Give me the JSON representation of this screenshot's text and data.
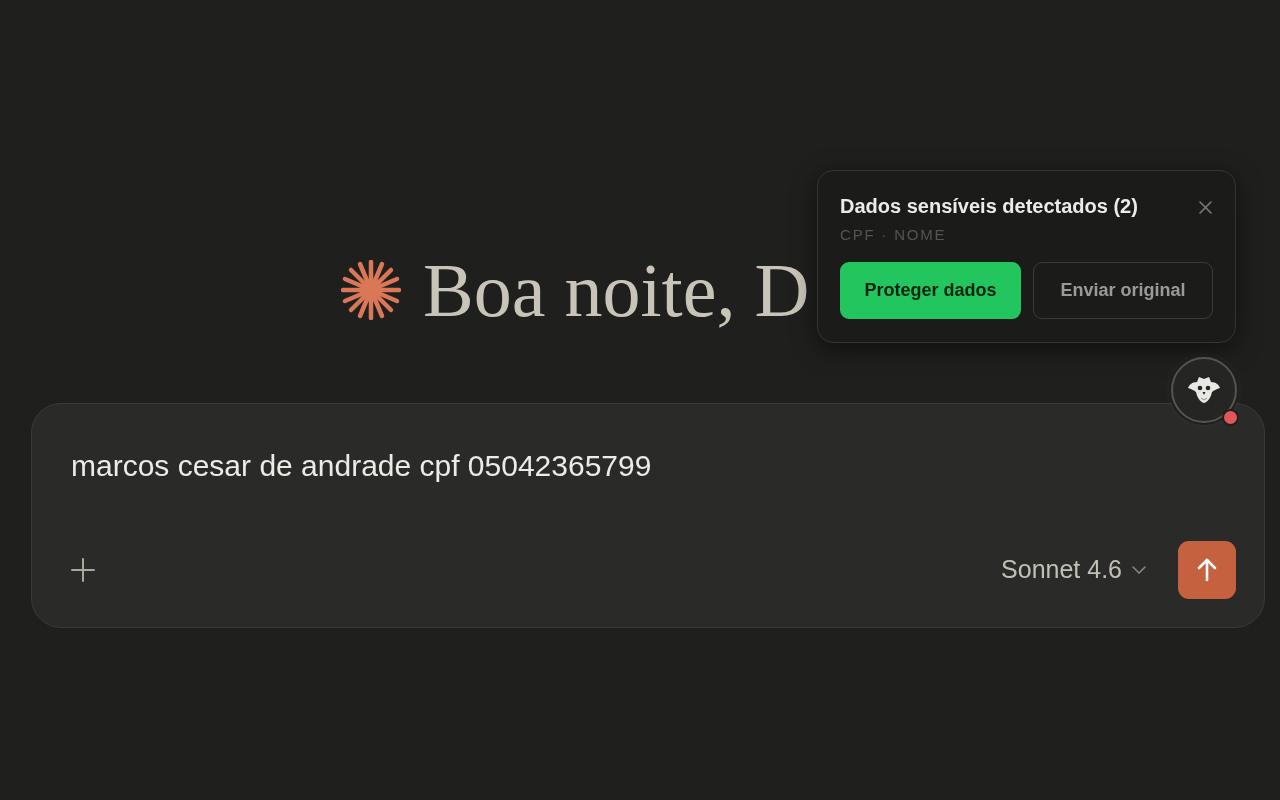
{
  "greeting": {
    "text": "Boa noite, D"
  },
  "composer": {
    "value": "marcos cesar de andrade cpf 05042365799",
    "model": "Sonnet 4.6"
  },
  "assistant_badge": {
    "alert": true
  },
  "alert_popup": {
    "title": "Dados sensíveis detectados (2)",
    "detected": "CPF · NOME",
    "buttons": [
      {
        "label": "Proteger dados",
        "kind": "primary"
      },
      {
        "label": "Enviar original",
        "kind": "secondary"
      }
    ]
  }
}
